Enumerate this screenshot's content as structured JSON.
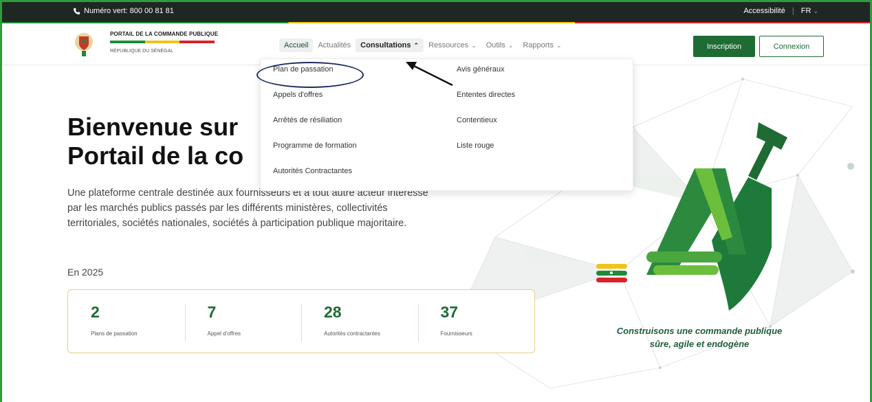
{
  "topbar": {
    "phone_label": "Numéro vert: 800 00 81 81",
    "accessibility_label": "Accessibilité",
    "separator": "|",
    "language_label": "FR"
  },
  "brand": {
    "title": "PORTAIL DE LA COMMANDE PUBLIQUE",
    "subtitle": "RÉPUBLIQUE DU SÉNÉGAL",
    "flag_colors": [
      "#1e8a3a",
      "#f0c419",
      "#d6242a"
    ]
  },
  "nav": {
    "items": [
      {
        "label": "Accueil",
        "state": "active"
      },
      {
        "label": "Actualités",
        "state": "default"
      },
      {
        "label": "Consultations",
        "state": "open",
        "chevron": "up"
      },
      {
        "label": "Ressources",
        "state": "default",
        "chevron": "down"
      },
      {
        "label": "Outils",
        "state": "default",
        "chevron": "down"
      },
      {
        "label": "Rapports",
        "state": "default",
        "chevron": "down"
      }
    ]
  },
  "buttons": {
    "inscription": "Inscription",
    "connexion": "Connexion"
  },
  "dropdown": {
    "column1": [
      "Plan de passation",
      "Appels d'offres",
      "Arrêtés de résiliation",
      "Programme de formation",
      "Autorités Contractantes"
    ],
    "column2": [
      "Avis généraux",
      "Ententes directes",
      "Contentieux",
      "Liste rouge"
    ]
  },
  "hero": {
    "title_line1": "Bienvenue sur",
    "title_line2": "Portail de la co",
    "description": "Une plateforme centrale destinée aux fournisseurs et à tout autre acteur intéressé par les marchés publics passés par les différents ministères, collectivités territoriales, sociétés nationales, sociétés à participation publique majoritaire.",
    "year_label": "En 2025"
  },
  "stats": [
    {
      "value": "2",
      "label": "Plans de passation"
    },
    {
      "value": "7",
      "label": "Appel d'offres"
    },
    {
      "value": "28",
      "label": "Autorités contractantes"
    },
    {
      "value": "37",
      "label": "Fournisseurs"
    }
  ],
  "illustration": {
    "tagline_line1": "Construisons une commande publique",
    "tagline_line2": "sûre, agile et endogène"
  },
  "colors": {
    "primary_green": "#1e6b34",
    "frame_green": "#2f9c3a",
    "annotation_navy": "#1f2a5c"
  }
}
